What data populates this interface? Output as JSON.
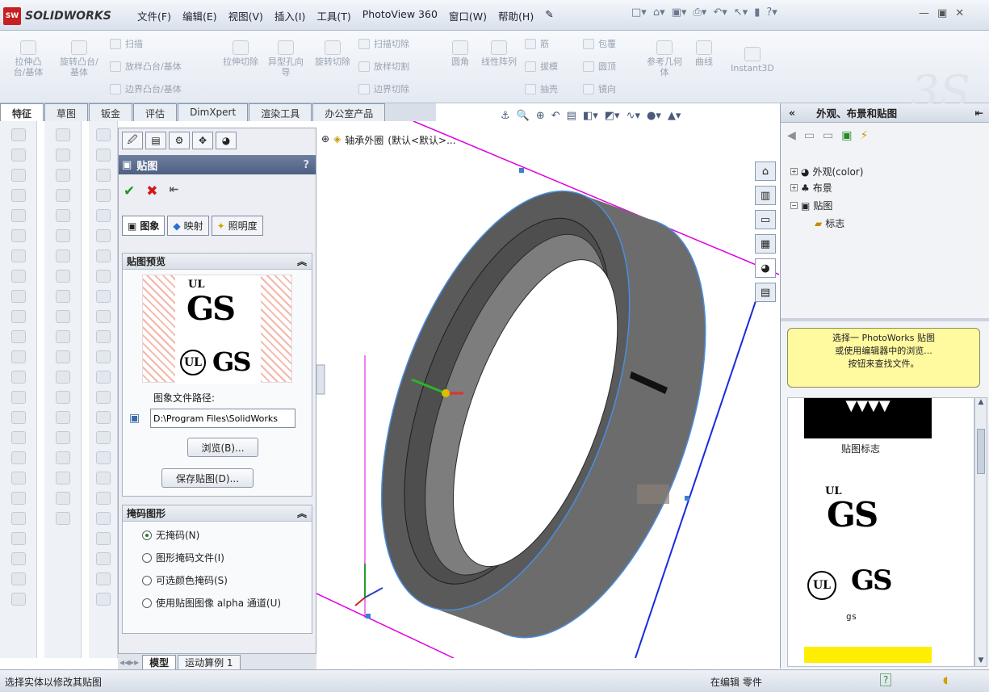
{
  "app": {
    "logo": "SOLIDWORKS",
    "logo_badge": "SW"
  },
  "menu": [
    "文件(F)",
    "编辑(E)",
    "视图(V)",
    "插入(I)",
    "工具(T)",
    "PhotoView 360",
    "窗口(W)",
    "帮助(H)"
  ],
  "ribbon": {
    "big_buttons": [
      "拉伸凸台/基体",
      "旋转凸台/基体",
      "拉伸切除",
      "异型孔向导",
      "旋转切除",
      "圆角",
      "线性阵列",
      "参考几何体",
      "曲线",
      "Instant3D"
    ],
    "small": {
      "sweep": "扫描",
      "loft": "放样凸台/基体",
      "boundary": "边界凸台/基体",
      "sweep_cut": "扫描切除",
      "loft_cut": "放样切割",
      "boundary_cut": "边界切除",
      "rib": "筋",
      "draft": "拔模",
      "shell": "抽壳",
      "wrap": "包覆",
      "dome": "圆顶",
      "mirror": "镜向"
    }
  },
  "command_tabs": [
    "特征",
    "草图",
    "钣金",
    "评估",
    "DimXpert",
    "渲染工具",
    "办公室产品"
  ],
  "property_manager": {
    "title": "贴图",
    "help": "?",
    "subtabs": [
      "图象",
      "映射",
      "照明度"
    ],
    "preview_group": "贴图预览",
    "path_label": "图象文件路径:",
    "path_value": "D:\\Program Files\\SolidWorks ",
    "browse": "浏览(B)...",
    "save": "保存贴图(D)...",
    "mask_group": "掩码图形",
    "mask_options": [
      "无掩码(N)",
      "图形掩码文件(I)",
      "可选颜色掩码(S)",
      "使用贴图图像 alpha 通道(U)"
    ],
    "logo_ul": "UL",
    "logo_gs": "GS"
  },
  "bottom_tabs": [
    "模型",
    "运动算例 1"
  ],
  "viewport": {
    "tree_label": "轴承外圈",
    "config": "(默认<默认>..."
  },
  "task_pane": {
    "title": "外观、布景和贴图",
    "tree": [
      "外观(color)",
      "布景",
      "贴图",
      "标志"
    ],
    "tip": [
      "选择一 PhotoWorks 贴图",
      "或使用编辑器中的浏览...",
      "按钮来查找文件。"
    ],
    "item1_caption": "贴图标志",
    "item2_caption": "gs"
  },
  "status": {
    "left": "选择实体以修改其贴图",
    "mode": "在编辑 零件"
  }
}
